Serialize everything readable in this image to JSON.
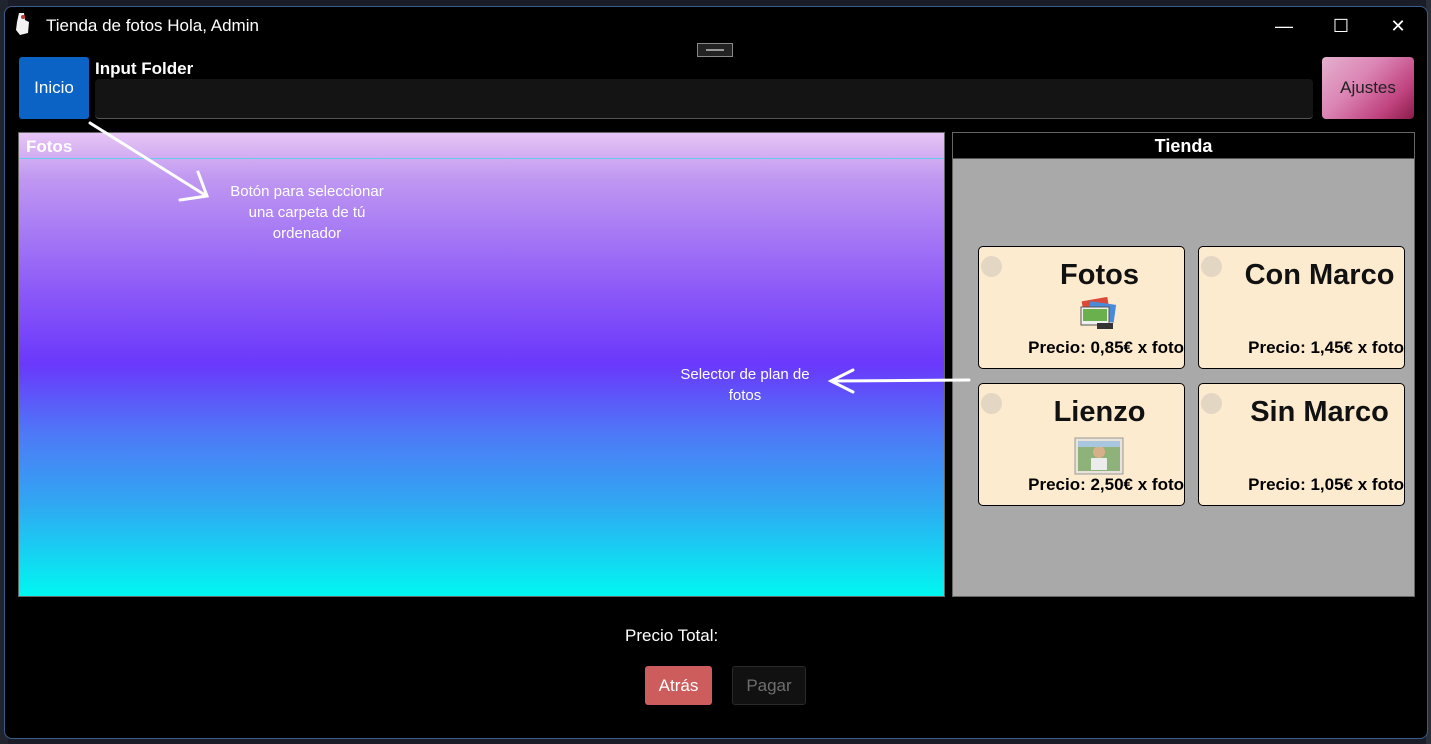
{
  "window": {
    "title": "Tienda de fotos Hola, Admin",
    "minimize_glyph": "—",
    "maximize_glyph": "☐",
    "close_glyph": "✕"
  },
  "toolbar": {
    "inicio_label": "Inicio",
    "input_label": "Input Folder",
    "input_value": "",
    "ajustes_label": "Ajustes"
  },
  "fotos_panel": {
    "title": "Fotos"
  },
  "annotations": {
    "folder_note": "Botón para seleccionar una carpeta de tú ordenador",
    "plan_note": "Selector de plan de fotos"
  },
  "tienda": {
    "title": "Tienda",
    "plans": [
      {
        "name": "Fotos",
        "price": "Precio: 0,85€ x foto",
        "icon": "photo-stack-icon"
      },
      {
        "name": "Con Marco",
        "price": "Precio: 1,45€ x foto",
        "icon": ""
      },
      {
        "name": "Lienzo",
        "price": "Precio: 2,50€ x foto",
        "icon": "canvas-print-icon"
      },
      {
        "name": "Sin Marco",
        "price": "Precio: 1,05€ x foto",
        "icon": ""
      }
    ]
  },
  "footer": {
    "total_label": "Precio Total:",
    "atras_label": "Atrás",
    "pagar_label": "Pagar"
  },
  "colors": {
    "inicio_bg": "#0a63c5",
    "atras_bg": "#cd5c5c",
    "plan_card_bg": "#fdebd0",
    "tienda_bg": "#a9a9a9",
    "window_border": "#3a5c8c"
  }
}
